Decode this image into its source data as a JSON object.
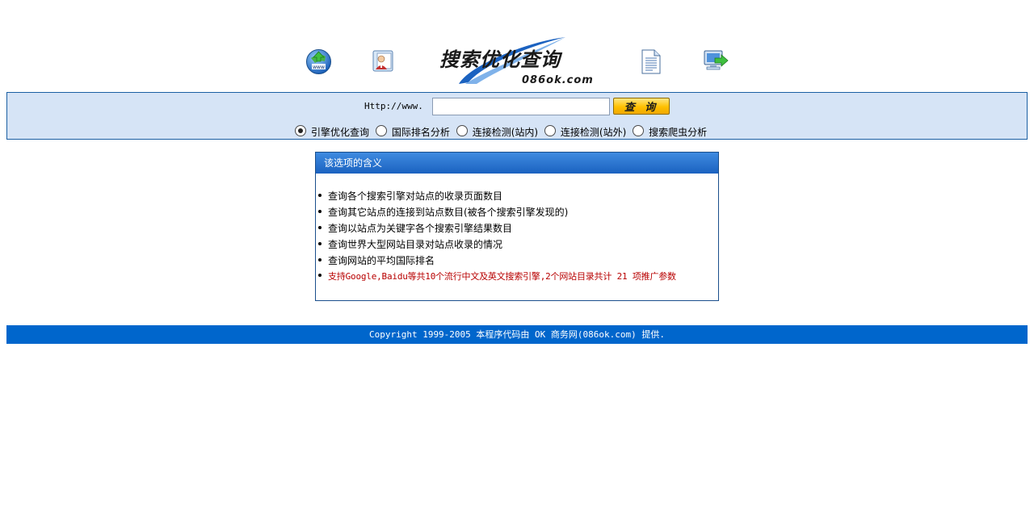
{
  "header": {
    "icons": [
      "globe-www-icon",
      "user-card-icon",
      "document-icon",
      "computer-arrow-icon"
    ],
    "logo_title": "搜索优化查询",
    "logo_domain": "086ok.com"
  },
  "search": {
    "prefix_label": "Http://www.",
    "input_value": "",
    "button_label": "查 询",
    "options": [
      {
        "label": "引擎优化查询",
        "selected": true
      },
      {
        "label": "国际排名分析",
        "selected": false
      },
      {
        "label": "连接检测(站内)",
        "selected": false
      },
      {
        "label": "连接检测(站外)",
        "selected": false
      },
      {
        "label": "搜索爬虫分析",
        "selected": false
      }
    ]
  },
  "info": {
    "title": "该选项的含义",
    "items": [
      "查询各个搜索引擎对站点的收录页面数目",
      "查询其它站点的连接到站点数目(被各个搜索引擎发现的)",
      "查询以站点为关键字各个搜索引擎结果数目",
      "查询世界大型网站目录对站点收录的情况",
      "查询网站的平均国际排名",
      "支持Google,Baidu等共10个流行中文及英文搜索引擎,2个网站目录共计 21 项推广参数"
    ],
    "highlight_color": "#b80000"
  },
  "footer": {
    "text": "Copyright 1999-2005 本程序代码由 OK 商务网(086ok.com) 提供."
  },
  "colors": {
    "panel_bg": "#d6e4f6",
    "panel_border": "#1b5fa3",
    "footer_bg": "#0066cc"
  }
}
